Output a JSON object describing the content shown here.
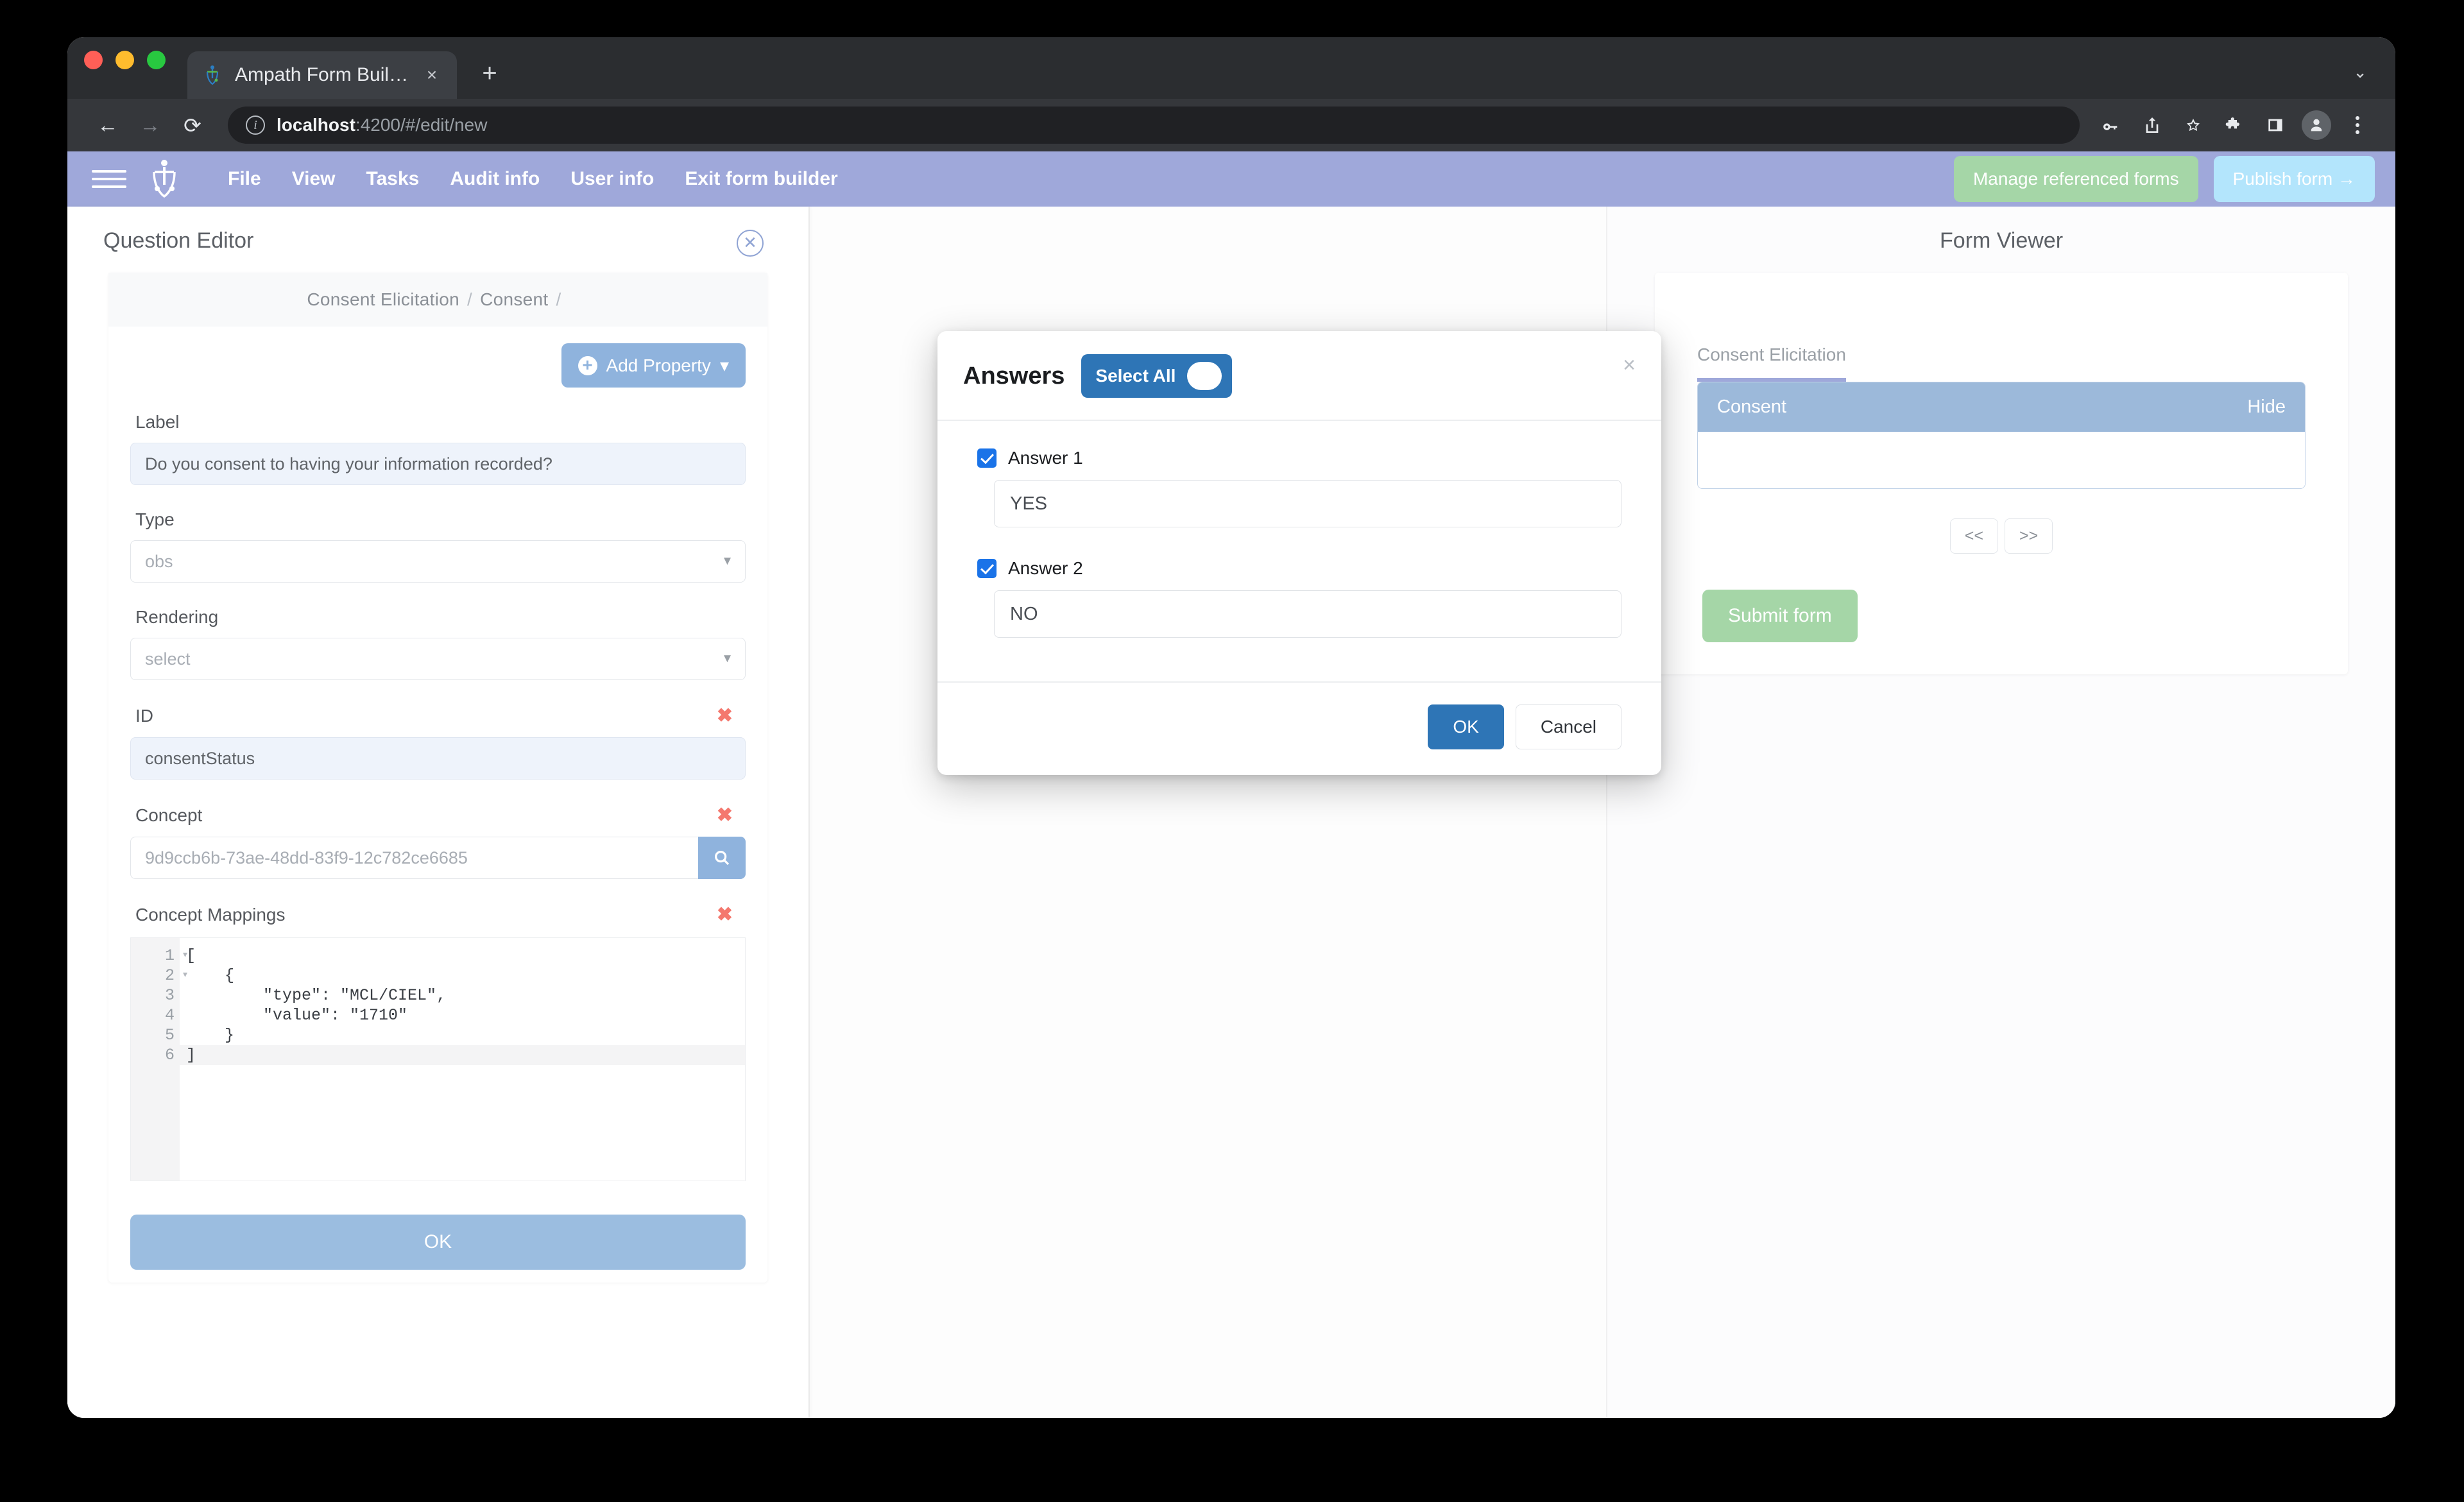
{
  "browser": {
    "tab": {
      "title": "Ampath Form Builder",
      "favicon": "ampath-logo-icon",
      "close": "×"
    },
    "new_tab": "+",
    "window_caret": "⌄",
    "nav": {
      "back": "←",
      "forward": "→",
      "reload": "⟳"
    },
    "omnibox": {
      "info_icon": "info-icon",
      "url_host": "localhost",
      "url_rest": ":4200/#/edit/new"
    },
    "toolbar_icons": [
      "key-icon",
      "share-icon",
      "star-icon",
      "extensions-puzzle-icon",
      "side-panel-icon",
      "profile-avatar-icon",
      "overflow-menu-icon"
    ]
  },
  "app_header": {
    "menu_icon": "hamburger-menu-icon",
    "logo": "ampath-logo-icon",
    "items": [
      {
        "label": "File"
      },
      {
        "label": "View"
      },
      {
        "label": "Tasks"
      },
      {
        "label": "Audit info"
      },
      {
        "label": "User info"
      },
      {
        "label": "Exit form builder"
      }
    ],
    "manage_referenced_forms": "Manage referenced forms",
    "publish_form": "Publish form →",
    "accent_color": "#9fa8da",
    "green_button_color": "#a5d6a7",
    "blue_button_color": "#b3e5fc"
  },
  "question_editor": {
    "title": "Question Editor",
    "close_icon": "close-circle-icon",
    "breadcrumb": [
      "Consent Elicitation",
      "Consent",
      ""
    ],
    "add_property": "Add Property",
    "add_property_caret": "▾",
    "fields": [
      {
        "name": "label",
        "label": "Label",
        "value": "Do you consent to having your information recorded?",
        "filled": true,
        "removable": false,
        "kind": "text"
      },
      {
        "name": "type",
        "label": "Type",
        "value": "obs",
        "filled": false,
        "removable": false,
        "kind": "select"
      },
      {
        "name": "rendering",
        "label": "Rendering",
        "value": "select",
        "filled": false,
        "removable": false,
        "kind": "select"
      },
      {
        "name": "id",
        "label": "ID",
        "value": "consentStatus",
        "filled": true,
        "removable": true,
        "kind": "text"
      },
      {
        "name": "concept",
        "label": "Concept",
        "value": "9d9ccb6b-73ae-48dd-83f9-12c782ce6685",
        "filled": false,
        "removable": true,
        "kind": "search"
      }
    ],
    "concept_mappings": {
      "label": "Concept Mappings",
      "removable": true,
      "lines": [
        {
          "n": "1",
          "fold": true,
          "text": "["
        },
        {
          "n": "2",
          "fold": true,
          "text": "    {"
        },
        {
          "n": "3",
          "fold": false,
          "text": "        \"type\": \"MCL/CIEL\","
        },
        {
          "n": "4",
          "fold": false,
          "text": "        \"value\": \"1710\""
        },
        {
          "n": "5",
          "fold": false,
          "text": "    }"
        },
        {
          "n": "6",
          "fold": false,
          "text": "]"
        }
      ]
    },
    "ok_button": "OK",
    "remove_marker": "✖"
  },
  "form_viewer": {
    "title": "Form Viewer",
    "tabs": [
      {
        "label": "Consent Elicitation",
        "active": true
      }
    ],
    "section": {
      "title": "Consent",
      "hide_label": "Hide"
    },
    "pager": {
      "prev": "<<",
      "next": ">>"
    },
    "submit": "Submit form"
  },
  "answers_modal": {
    "title": "Answers",
    "select_all_label": "Select All",
    "select_all_on": true,
    "close": "×",
    "answers": [
      {
        "label": "Answer 1",
        "checked": true,
        "value": "YES"
      },
      {
        "label": "Answer 2",
        "checked": true,
        "value": "NO"
      }
    ],
    "ok": "OK",
    "cancel": "Cancel",
    "primary_color": "#2e75b6",
    "checkbox_color": "#1a73e8"
  }
}
